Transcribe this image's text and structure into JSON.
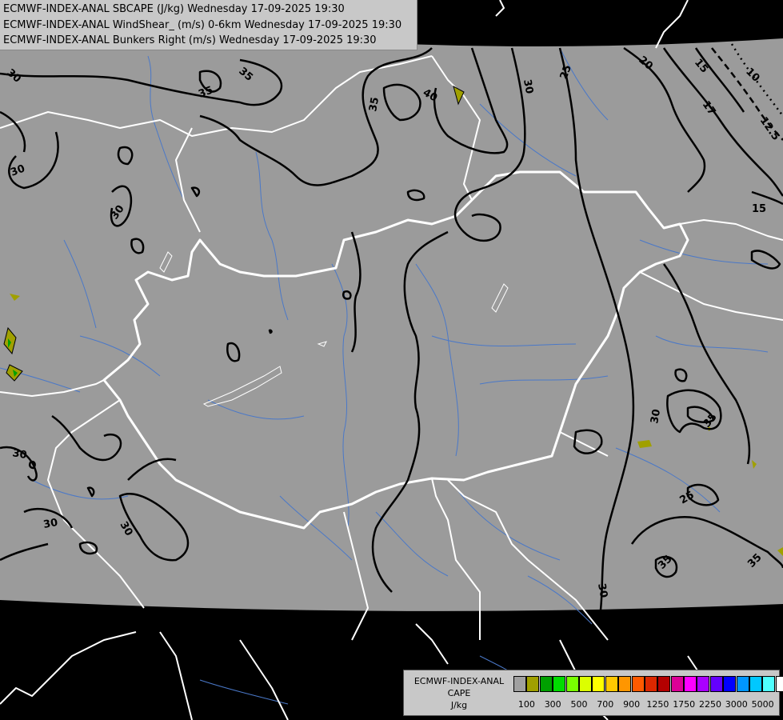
{
  "title_lines": [
    "ECMWF-INDEX-ANAL SBCAPE (J/kg) Wednesday 17-09-2025 19:30",
    "ECMWF-INDEX-ANAL WindShear_ (m/s) 0-6km Wednesday 17-09-2025 19:30",
    "ECMWF-INDEX-ANAL Bunkers Right (m/s) Wednesday 17-09-2025 19:30"
  ],
  "legend": {
    "title_1": "ECMWF-INDEX-ANAL",
    "title_2": "CAPE",
    "title_3": "J/kg",
    "colors": [
      "#a0a0a0",
      "#a0a000",
      "#00a000",
      "#00dc00",
      "#78ff00",
      "#dcff00",
      "#ffff00",
      "#ffc800",
      "#ff9600",
      "#ff5a00",
      "#dc2800",
      "#b40000",
      "#dc0096",
      "#ff00ff",
      "#aa00ff",
      "#6400ff",
      "#0000ff",
      "#0096ff",
      "#00c8ff",
      "#50ffff",
      "#ffffff"
    ],
    "labels": [
      "100",
      "300",
      "500",
      "700",
      "900",
      "1250",
      "1750",
      "2250",
      "3000",
      "5000"
    ]
  },
  "contour_labels": [
    "30",
    "35",
    "35",
    "35",
    "40",
    "30",
    "25",
    "20",
    "15",
    "17",
    "10",
    "12.5",
    "30",
    "30",
    "15",
    "30",
    "30",
    "30",
    "35",
    "25",
    "30",
    "35",
    "35"
  ],
  "colors": {
    "map_fill": "#9b9b9b",
    "outside": "#000000",
    "rivers": "#4a78c8",
    "borders": "#ffffff",
    "contours": "#000000",
    "cape_low": "#a0a000",
    "cape_mid": "#00a000"
  }
}
